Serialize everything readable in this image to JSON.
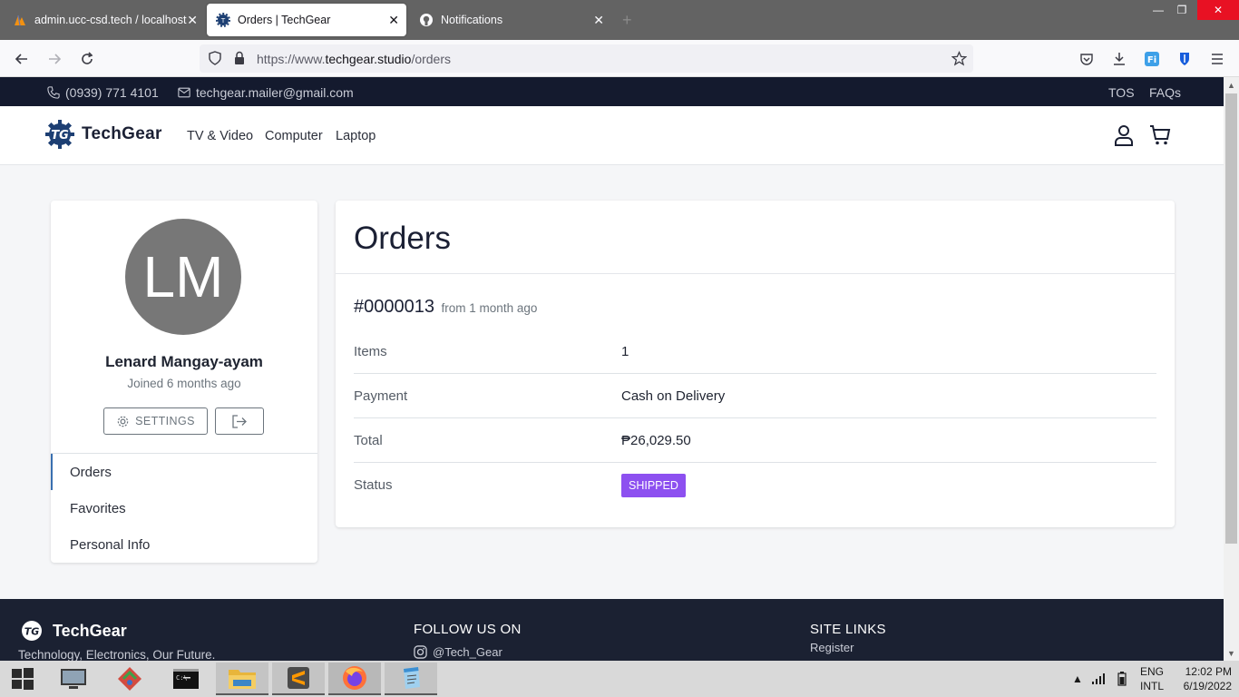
{
  "browser": {
    "tabs": [
      {
        "title": "admin.ucc-csd.tech / localhost",
        "active": false
      },
      {
        "title": "Orders | TechGear",
        "active": true
      },
      {
        "title": "Notifications",
        "active": false
      }
    ],
    "url_prefix": "https://www.",
    "url_host": "techgear.studio",
    "url_path": "/orders",
    "window_controls": {
      "minimize": "—",
      "restore": "❐",
      "close": "✕"
    }
  },
  "topbar": {
    "phone": "(0939) 771 4101",
    "email": "techgear.mailer@gmail.com",
    "links": [
      "TOS",
      "FAQs"
    ]
  },
  "header": {
    "brand": "TechGear",
    "nav": [
      "TV & Video",
      "Computer",
      "Laptop"
    ]
  },
  "profile": {
    "initials": "LM",
    "name": "Lenard Mangay-ayam",
    "joined": "Joined 6 months ago",
    "settings_label": "SETTINGS",
    "menu": [
      "Orders",
      "Favorites",
      "Personal Info"
    ]
  },
  "orders": {
    "title": "Orders",
    "order_number": "#0000013",
    "order_age": "from 1 month ago",
    "rows": [
      {
        "label": "Items",
        "value": "1"
      },
      {
        "label": "Payment",
        "value": "Cash on Delivery"
      },
      {
        "label": "Total",
        "value": "₱26,029.50"
      },
      {
        "label": "Status",
        "value": "SHIPPED"
      }
    ],
    "status_color": "#8d50f0"
  },
  "footer": {
    "brand": "TechGear",
    "tagline": "Technology, Electronics, Our Future.",
    "follow_title": "FOLLOW US ON",
    "instagram": "@Tech_Gear",
    "links_title": "SITE LINKS",
    "links": [
      "Register"
    ]
  },
  "taskbar": {
    "lang_top": "ENG",
    "lang_bottom": "INTL",
    "time": "12:02 PM",
    "date": "6/19/2022"
  }
}
